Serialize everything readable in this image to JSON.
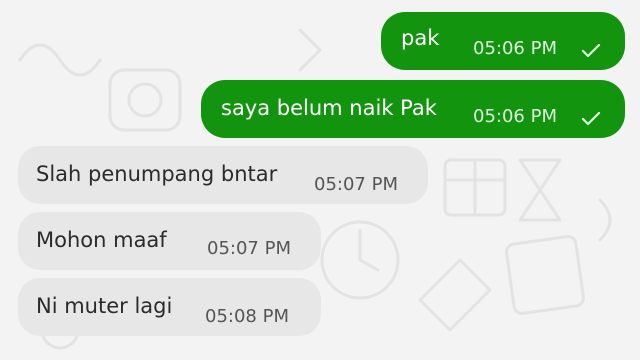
{
  "chat": {
    "messages": [
      {
        "direction": "outgoing",
        "text": "pak",
        "time": "05:06 PM",
        "status": "sent-check"
      },
      {
        "direction": "outgoing",
        "text": "saya belum naik Pak",
        "time": "05:06 PM",
        "status": "sent-check"
      },
      {
        "direction": "incoming",
        "text": "Slah penumpang bntar",
        "time": "05:07 PM"
      },
      {
        "direction": "incoming",
        "text": "Mohon maaf",
        "time": "05:07 PM"
      },
      {
        "direction": "incoming",
        "text": "Ni muter lagi",
        "time": "05:08 PM"
      }
    ]
  },
  "colors": {
    "outgoing_bubble": "#13940f",
    "incoming_bubble": "#e7e7e7",
    "background": "#f3f3f3"
  },
  "icons": {
    "status": "check-icon"
  }
}
